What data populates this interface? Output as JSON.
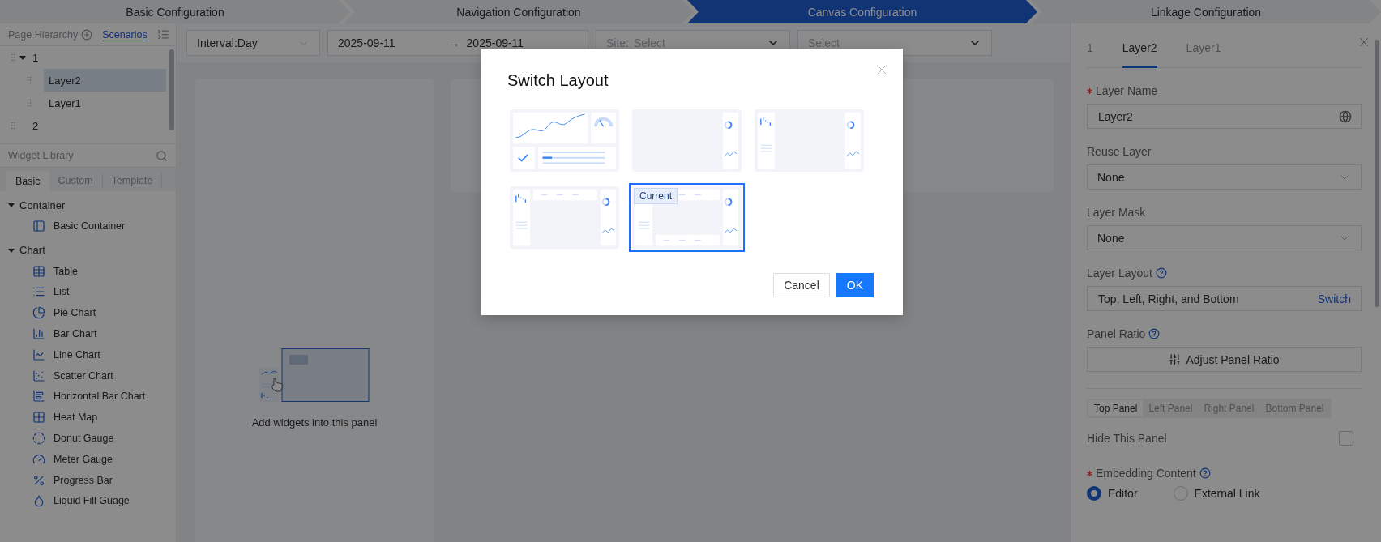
{
  "steps": [
    {
      "label": "Basic Configuration",
      "selected": false
    },
    {
      "label": "Navigation Configuration",
      "selected": false
    },
    {
      "label": "Canvas Configuration",
      "selected": true
    },
    {
      "label": "Linkage Configuration",
      "selected": false
    }
  ],
  "sidebar": {
    "hierarchy_tabs": [
      {
        "label": "Page Hierarchy",
        "selected": false
      },
      {
        "label": "Scenarios",
        "selected": true
      }
    ],
    "tree": [
      {
        "label": "1",
        "expanded": true,
        "selected": false,
        "children": [
          {
            "label": "Layer2",
            "selected": true
          },
          {
            "label": "Layer1",
            "selected": false
          }
        ]
      },
      {
        "label": "2",
        "selected": false
      }
    ],
    "widget_library": {
      "title": "Widget Library",
      "tabs": [
        {
          "label": "Basic",
          "selected": true
        },
        {
          "label": "Custom",
          "selected": false
        },
        {
          "label": "Template",
          "selected": false
        }
      ],
      "groups": [
        {
          "label": "Container",
          "expanded": true,
          "items": [
            {
              "label": "Basic Container",
              "kind": "container"
            }
          ]
        },
        {
          "label": "Chart",
          "expanded": true,
          "items": [
            {
              "label": "Table",
              "kind": "table"
            },
            {
              "label": "List",
              "kind": "list"
            },
            {
              "label": "Pie Chart",
              "kind": "pie"
            },
            {
              "label": "Bar Chart",
              "kind": "bar"
            },
            {
              "label": "Line Chart",
              "kind": "line"
            },
            {
              "label": "Scatter Chart",
              "kind": "scatter"
            },
            {
              "label": "Horizontal Bar Chart",
              "kind": "hbar"
            },
            {
              "label": "Heat Map",
              "kind": "heatmap"
            },
            {
              "label": "Donut Gauge",
              "kind": "donut"
            },
            {
              "label": "Meter Gauge",
              "kind": "meter"
            },
            {
              "label": "Progress Bar",
              "kind": "progress"
            },
            {
              "label": "Liquid Fill Guage",
              "kind": "liquid"
            }
          ]
        }
      ]
    }
  },
  "toolbar": {
    "interval": "Interval:Day",
    "date_start": "2025-09-11",
    "date_separator": "→",
    "date_end": "2025-09-11",
    "site": {
      "label": "Site:",
      "placeholder": "Select"
    },
    "filter_4": {
      "placeholder": "Select"
    }
  },
  "canvas": {
    "empty_text": "Add widgets into this panel"
  },
  "properties": {
    "tabs": [
      {
        "label": "1",
        "selected": false
      },
      {
        "label": "Layer2",
        "selected": true
      },
      {
        "label": "Layer1",
        "selected": false
      }
    ],
    "layer_name": {
      "label": "Layer Name",
      "required": true,
      "value": "Layer2"
    },
    "reuse_layer": {
      "label": "Reuse Layer",
      "value": "None"
    },
    "layer_mask": {
      "label": "Layer Mask",
      "value": "None"
    },
    "layer_layout": {
      "label": "Layer Layout",
      "value": "Top, Left, Right, and Bottom",
      "action": "Switch"
    },
    "panel_ratio": {
      "label": "Panel Ratio",
      "button": "Adjust Panel Ratio"
    },
    "panel_tabs": [
      {
        "label": "Top Panel",
        "selected": true
      },
      {
        "label": "Left Panel",
        "selected": false
      },
      {
        "label": "Right Panel",
        "selected": false
      },
      {
        "label": "Bottom Panel",
        "selected": false
      }
    ],
    "hide_panel": {
      "label": "Hide This Panel",
      "checked": false
    },
    "embedding": {
      "label": "Embedding Content",
      "required": true,
      "options": [
        {
          "label": "Editor",
          "selected": true
        },
        {
          "label": "External Link",
          "selected": false
        }
      ]
    }
  },
  "modal": {
    "title": "Switch Layout",
    "current_label": "Current",
    "layouts": [
      {
        "kind": "dashboard",
        "selected": false
      },
      {
        "kind": "right",
        "selected": false
      },
      {
        "kind": "left-right",
        "selected": false
      },
      {
        "kind": "top-left-right",
        "selected": false
      },
      {
        "kind": "top-left-right-bottom",
        "selected": true
      }
    ],
    "buttons": [
      {
        "label": "Cancel",
        "kind": "secondary"
      },
      {
        "label": "OK",
        "kind": "primary"
      }
    ]
  }
}
